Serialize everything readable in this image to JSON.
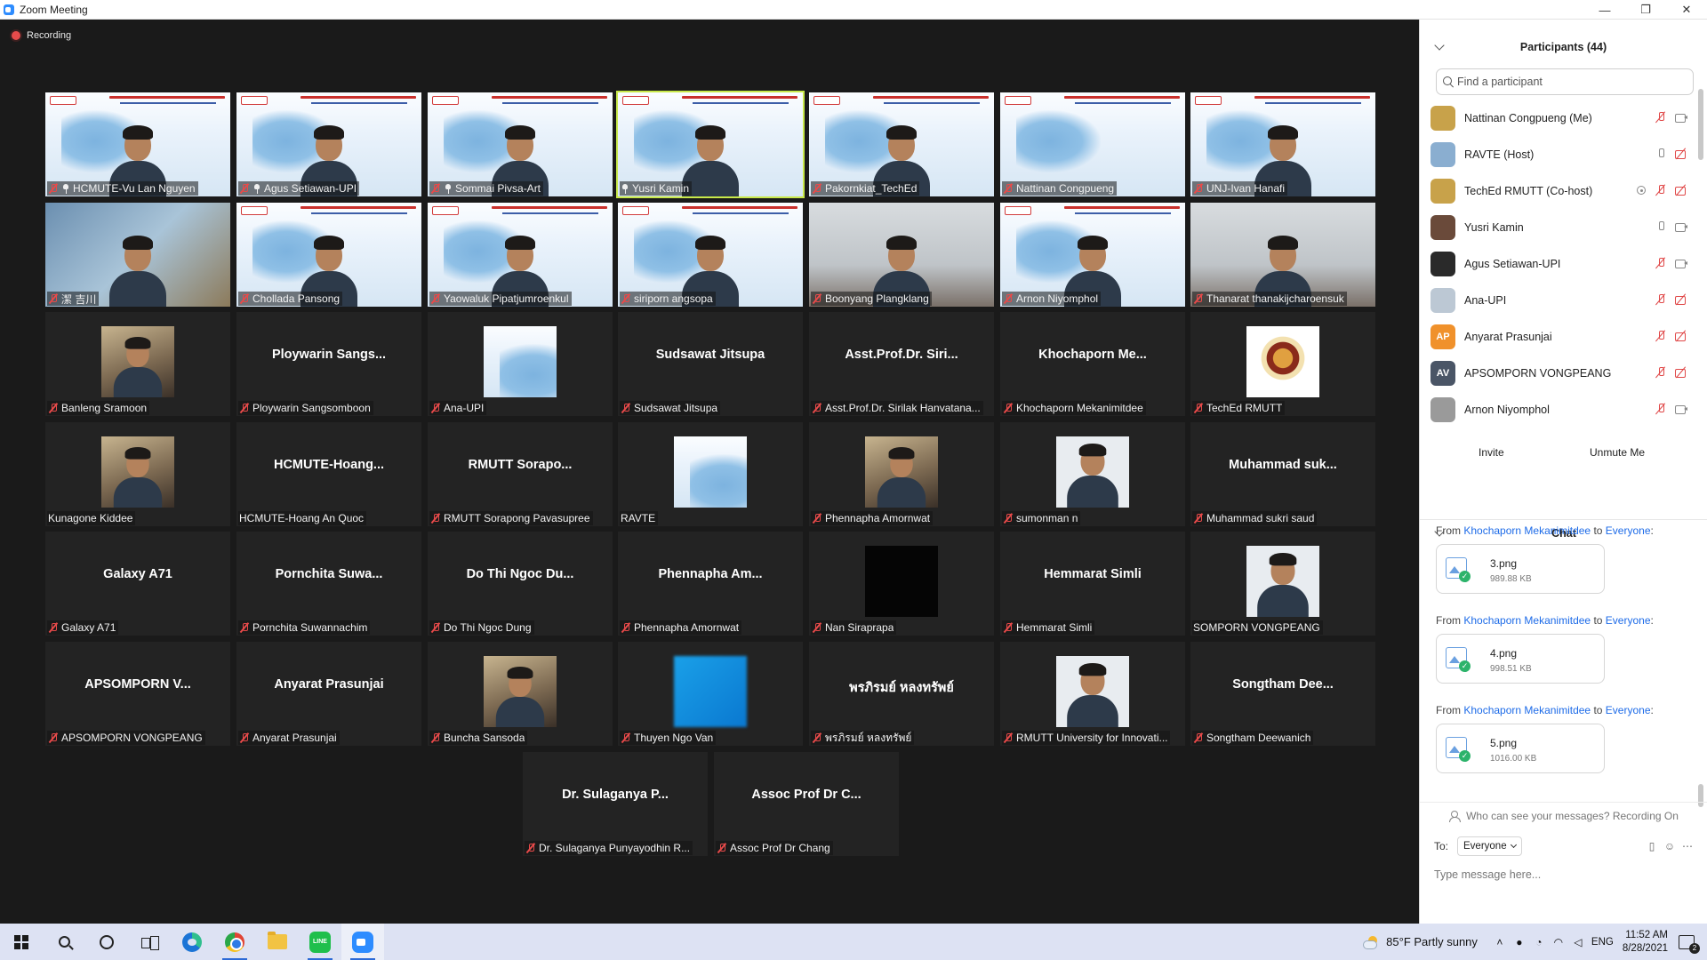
{
  "window": {
    "title": "Zoom Meeting",
    "minimize": "—",
    "restore": "❐",
    "close": "✕"
  },
  "recording": "Recording",
  "tiles": [
    {
      "label": "HCMUTE-Vu Lan Nguyen",
      "big": "",
      "bg": "slide",
      "person": true,
      "pinned": true,
      "muted": true
    },
    {
      "label": "Agus Setiawan-UPI",
      "big": "",
      "bg": "slide",
      "person": true,
      "pinned": true,
      "muted": true
    },
    {
      "label": "Sommai Pivsa-Art",
      "big": "",
      "bg": "slide",
      "person": true,
      "pinned": true,
      "muted": true
    },
    {
      "label": "Yusri Kamin",
      "big": "",
      "bg": "slide",
      "person": true,
      "pinned": true,
      "muted": false,
      "active": true
    },
    {
      "label": "Pakornkiat_TechEd",
      "big": "",
      "bg": "slide",
      "person": true,
      "pinned": false,
      "muted": true
    },
    {
      "label": "Nattinan Congpueng",
      "big": "",
      "bg": "slide",
      "person": false,
      "pinned": false,
      "muted": true
    },
    {
      "label": "UNJ-Ivan Hanafi",
      "big": "",
      "bg": "slide",
      "person": true,
      "pinned": false,
      "muted": true
    },
    {
      "label": "潔 吉川",
      "big": "",
      "bg": "room",
      "person": true,
      "pinned": false,
      "muted": true
    },
    {
      "label": "Chollada Pansong",
      "big": "",
      "bg": "slide",
      "person": true,
      "pinned": false,
      "muted": true
    },
    {
      "label": "Yaowaluk Pipatjumroenkul",
      "big": "",
      "bg": "slide",
      "person": true,
      "pinned": false,
      "muted": true
    },
    {
      "label": "siriporn angsopa",
      "big": "",
      "bg": "slide",
      "person": true,
      "pinned": false,
      "muted": true
    },
    {
      "label": "Boonyang Plangklang",
      "big": "",
      "bg": "window",
      "person": true,
      "pinned": false,
      "muted": true
    },
    {
      "label": "Arnon Niyomphol",
      "big": "",
      "bg": "slide",
      "person": true,
      "pinned": false,
      "muted": true
    },
    {
      "label": "Thanarat thanakijcharoensuk",
      "big": "",
      "bg": "window",
      "person": true,
      "pinned": false,
      "muted": true
    },
    {
      "label": "Banleng Sramoon",
      "big": "",
      "bg": "dark",
      "thumb": "photo",
      "muted": true
    },
    {
      "label": "Ploywarin Sangsomboon",
      "big": "Ploywarin  Sangs...",
      "bg": "dark",
      "muted": true
    },
    {
      "label": "Ana-UPI",
      "big": "",
      "bg": "dark",
      "thumb": "slide",
      "muted": true
    },
    {
      "label": "Sudsawat Jitsupa",
      "big": "Sudsawat  Jitsupa",
      "bg": "dark",
      "muted": true
    },
    {
      "label": "Asst.Prof.Dr. Sirilak Hanvatana...",
      "big": "Asst.Prof.Dr.  Siri...",
      "bg": "dark",
      "muted": true
    },
    {
      "label": "Khochaporn Mekanimitdee",
      "big": "Khochaporn  Me...",
      "bg": "dark",
      "muted": true
    },
    {
      "label": "TechEd RMUTT",
      "big": "",
      "bg": "dark",
      "thumb": "seal",
      "muted": true
    },
    {
      "label": "Kunagone Kiddee",
      "big": "",
      "bg": "dark",
      "thumb": "photo",
      "muted": false
    },
    {
      "label": "HCMUTE-Hoang An Quoc",
      "big": "HCMUTE-Hoang...",
      "bg": "dark",
      "muted": false
    },
    {
      "label": "RMUTT Sorapong Pavasupree",
      "big": "RMUTT  Sorapo...",
      "bg": "dark",
      "muted": true
    },
    {
      "label": "RAVTE",
      "big": "",
      "bg": "dark",
      "thumb": "slide",
      "muted": false
    },
    {
      "label": "Phennapha Amornwat",
      "big": "",
      "bg": "dark",
      "thumb": "photo",
      "muted": true
    },
    {
      "label": "sumonman n",
      "big": "",
      "bg": "dark",
      "thumb": "portrait",
      "muted": true
    },
    {
      "label": "Muhammad sukri saud",
      "big": "Muhammad  suk...",
      "bg": "dark",
      "muted": true
    },
    {
      "label": "Galaxy A71",
      "big": "Galaxy A71",
      "bg": "dark",
      "muted": true
    },
    {
      "label": "Pornchita Suwannachim",
      "big": "Pornchita  Suwa...",
      "bg": "dark",
      "muted": true
    },
    {
      "label": "Do Thi Ngoc Dung",
      "big": "Do Thi Ngoc Du...",
      "bg": "dark",
      "muted": true
    },
    {
      "label": "Phennapha Amornwat",
      "big": "Phennapha  Am...",
      "bg": "dark",
      "muted": true
    },
    {
      "label": "Nan Siraprapa",
      "big": "",
      "bg": "dark",
      "thumb": "black",
      "muted": true
    },
    {
      "label": "Hemmarat Simli",
      "big": "Hemmarat Simli",
      "bg": "dark",
      "muted": true
    },
    {
      "label": "SOMPORN VONGPEANG",
      "big": "",
      "bg": "dark",
      "thumb": "portrait",
      "muted": false
    },
    {
      "label": "APSOMPORN VONGPEANG",
      "big": "APSOMPORN  V...",
      "bg": "dark",
      "muted": true
    },
    {
      "label": "Anyarat Prasunjai",
      "big": "Anyarat Prasunjai",
      "bg": "dark",
      "muted": true
    },
    {
      "label": "Buncha Sansoda",
      "big": "",
      "bg": "dark",
      "thumb": "photo",
      "muted": true
    },
    {
      "label": "Thuyen Ngo Van",
      "big": "",
      "bg": "dark",
      "thumb": "blue",
      "muted": true
    },
    {
      "label": "พรภิรมย์ หลงทรัพย์",
      "big": "พรภิรมย์  หลงทรัพย์",
      "bg": "dark",
      "muted": true
    },
    {
      "label": "RMUTT University for Innovati...",
      "big": "",
      "bg": "dark",
      "thumb": "portrait",
      "muted": true
    },
    {
      "label": "Songtham Deewanich",
      "big": "Songtham  Dee...",
      "bg": "dark",
      "muted": true
    },
    {
      "label": "Dr. Sulaganya  Punyayodhin R...",
      "big": "Dr. Sulaganya   P...",
      "bg": "dark",
      "muted": true
    },
    {
      "label": "Assoc Prof Dr Chang",
      "big": "Assoc Prof Dr C...",
      "bg": "dark",
      "muted": true
    }
  ],
  "participants": {
    "title": "Participants (44)",
    "search_placeholder": "Find a participant",
    "list": [
      {
        "name": "Nattinan Congpueng (Me)",
        "initials": "",
        "color": "#c8a24a",
        "icons": [
          "mic-off",
          "cam"
        ]
      },
      {
        "name": "RAVTE (Host)",
        "initials": "",
        "color": "#8aaed0",
        "icons": [
          "mic-on",
          "cam-off"
        ]
      },
      {
        "name": "TechEd RMUTT (Co-host)",
        "initials": "",
        "color": "#c8a24a",
        "icons": [
          "share",
          "mic-off",
          "cam-off"
        ]
      },
      {
        "name": "Yusri Kamin",
        "initials": "",
        "color": "#6a4a3a",
        "icons": [
          "mic-on",
          "cam"
        ]
      },
      {
        "name": "Agus Setiawan-UPI",
        "initials": "",
        "color": "#2a2a2a",
        "icons": [
          "mic-off",
          "cam"
        ]
      },
      {
        "name": "Ana-UPI",
        "initials": "",
        "color": "#bcc8d4",
        "icons": [
          "mic-off",
          "cam-off"
        ]
      },
      {
        "name": "Anyarat Prasunjai",
        "initials": "AP",
        "color": "#f0912b",
        "icons": [
          "mic-off",
          "cam-off"
        ]
      },
      {
        "name": "APSOMPORN VONGPEANG",
        "initials": "AV",
        "color": "#4a5566",
        "icons": [
          "mic-off",
          "cam-off"
        ]
      },
      {
        "name": "Arnon Niyomphol",
        "initials": "",
        "color": "#9a9a9a",
        "icons": [
          "mic-off",
          "cam"
        ]
      }
    ],
    "invite": "Invite",
    "unmute_me": "Unmute Me"
  },
  "chat": {
    "title": "Chat",
    "messages": [
      {
        "from_prefix": "From ",
        "from": "Khochaporn Mekanimitdee",
        "to_prefix": " to ",
        "to": "Everyone",
        "suffix": ":",
        "file": "3.png",
        "size": "989.88 KB"
      },
      {
        "from_prefix": "From ",
        "from": "Khochaporn Mekanimitdee",
        "to_prefix": " to ",
        "to": "Everyone",
        "suffix": ":",
        "file": "4.png",
        "size": "998.51 KB"
      },
      {
        "from_prefix": "From ",
        "from": "Khochaporn Mekanimitdee",
        "to_prefix": " to ",
        "to": "Everyone",
        "suffix": ":",
        "file": "5.png",
        "size": "1016.00 KB"
      }
    ],
    "who_can_see": "Who can see your messages? Recording On",
    "to_label": "To:",
    "to_value": "Everyone",
    "input_placeholder": "Type message here..."
  },
  "taskbar": {
    "weather": "85°F  Partly sunny",
    "lang": "ENG",
    "time": "11:52 AM",
    "date": "8/28/2021",
    "line_label": "LINE"
  }
}
